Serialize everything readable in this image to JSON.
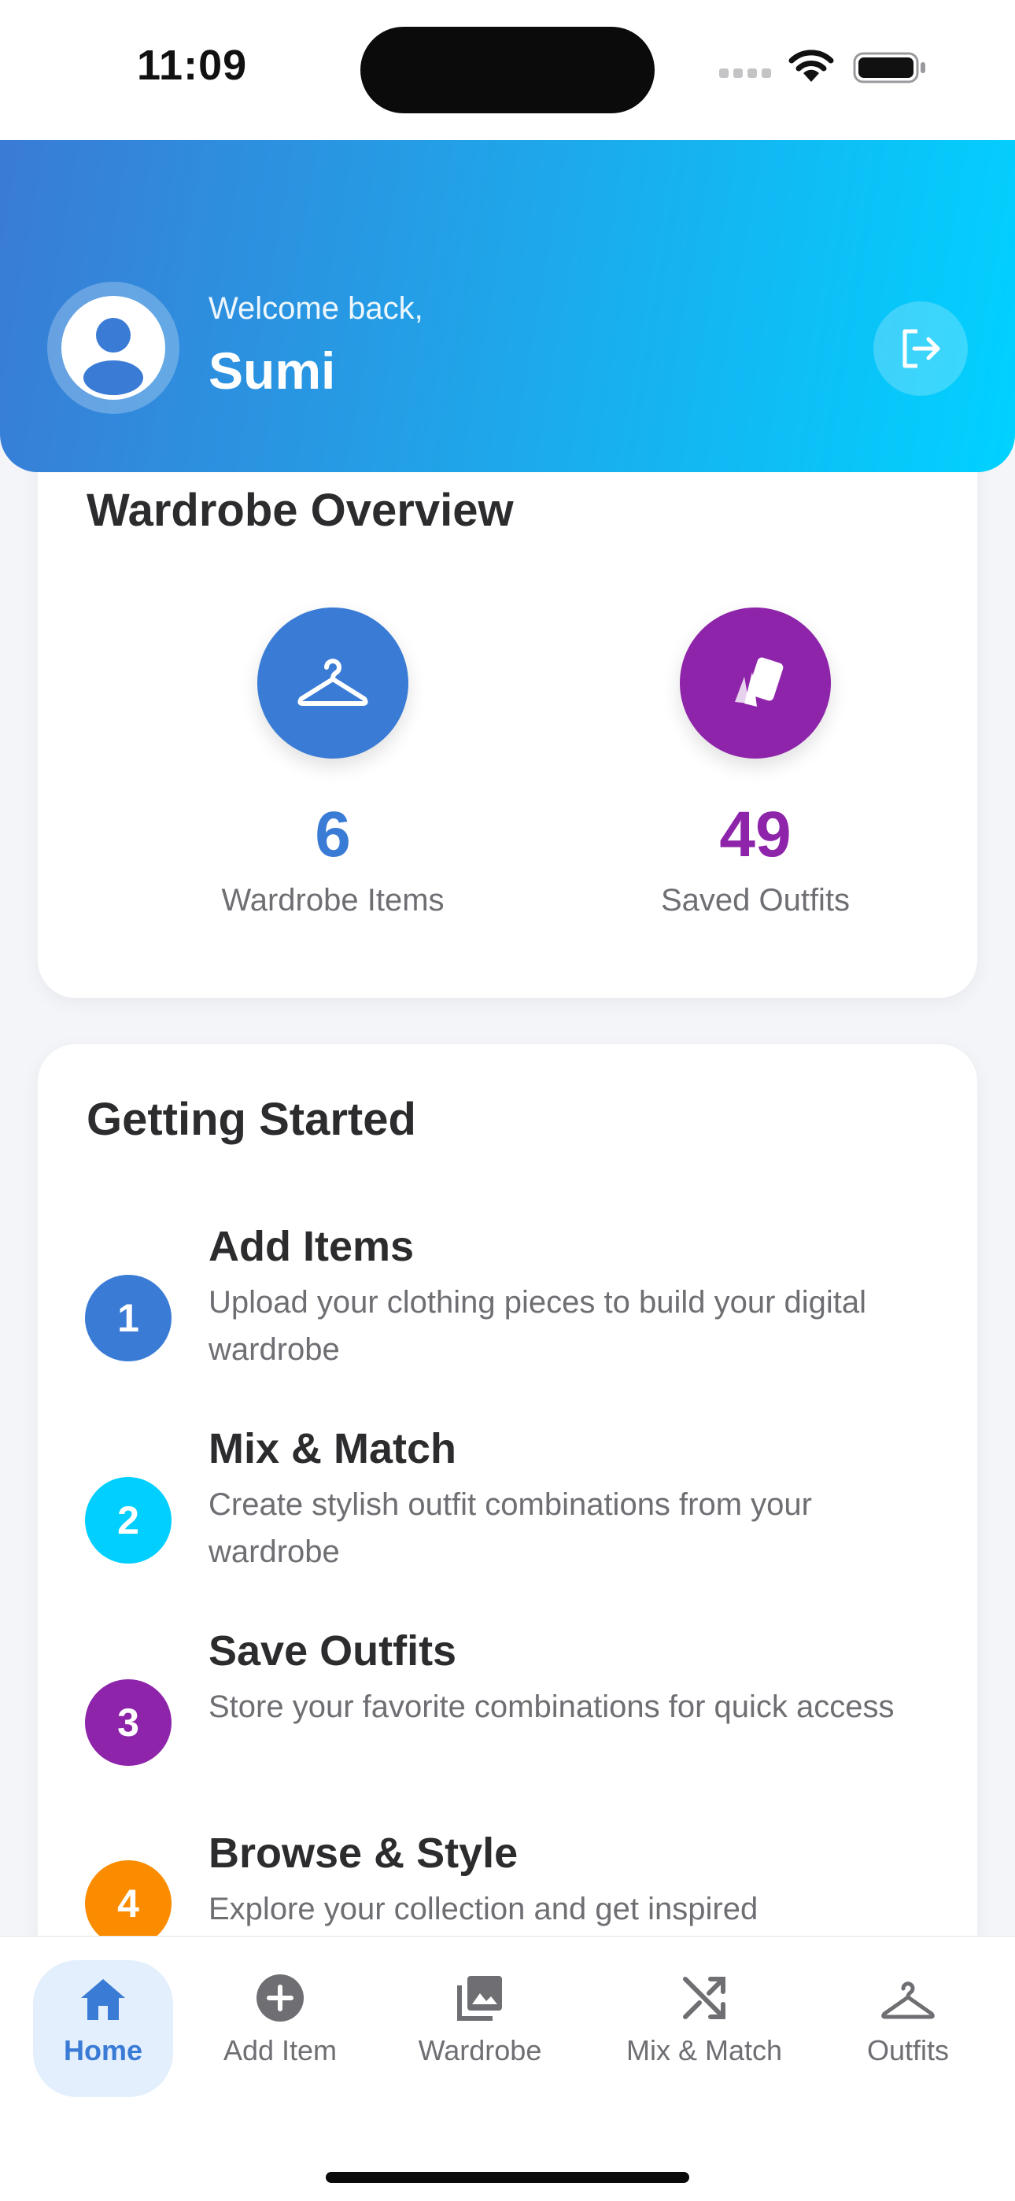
{
  "status_bar": {
    "time": "11:09"
  },
  "header": {
    "welcome": "Welcome back,",
    "username": "Sumi"
  },
  "overview": {
    "title": "Wardrobe Overview",
    "stats": [
      {
        "value": "6",
        "label": "Wardrobe Items",
        "color": "#3a7bd5",
        "icon": "hanger-icon"
      },
      {
        "value": "49",
        "label": "Saved Outfits",
        "color": "#8e24aa",
        "icon": "outfit-cards-icon"
      }
    ]
  },
  "getting_started": {
    "title": "Getting Started",
    "steps": [
      {
        "num": "1",
        "title": "Add Items",
        "desc": "Upload your clothing pieces to build your digital wardrobe",
        "color": "#3a7bd5"
      },
      {
        "num": "2",
        "title": "Mix & Match",
        "desc": "Create stylish outfit combinations from your wardrobe",
        "color": "#00cfff"
      },
      {
        "num": "3",
        "title": "Save Outfits",
        "desc": "Store your favorite combinations for quick access",
        "color": "#8e24aa"
      },
      {
        "num": "4",
        "title": "Browse & Style",
        "desc": "Explore your collection and get inspired",
        "color": "#fb8c00"
      }
    ]
  },
  "tabbar": {
    "tabs": [
      {
        "label": "Home",
        "icon": "home-icon",
        "active": true
      },
      {
        "label": "Add Item",
        "icon": "add-circle-icon"
      },
      {
        "label": "Wardrobe",
        "icon": "photo-library-icon"
      },
      {
        "label": "Mix & Match",
        "icon": "shuffle-icon"
      },
      {
        "label": "Outfits",
        "icon": "hanger-icon"
      }
    ]
  }
}
